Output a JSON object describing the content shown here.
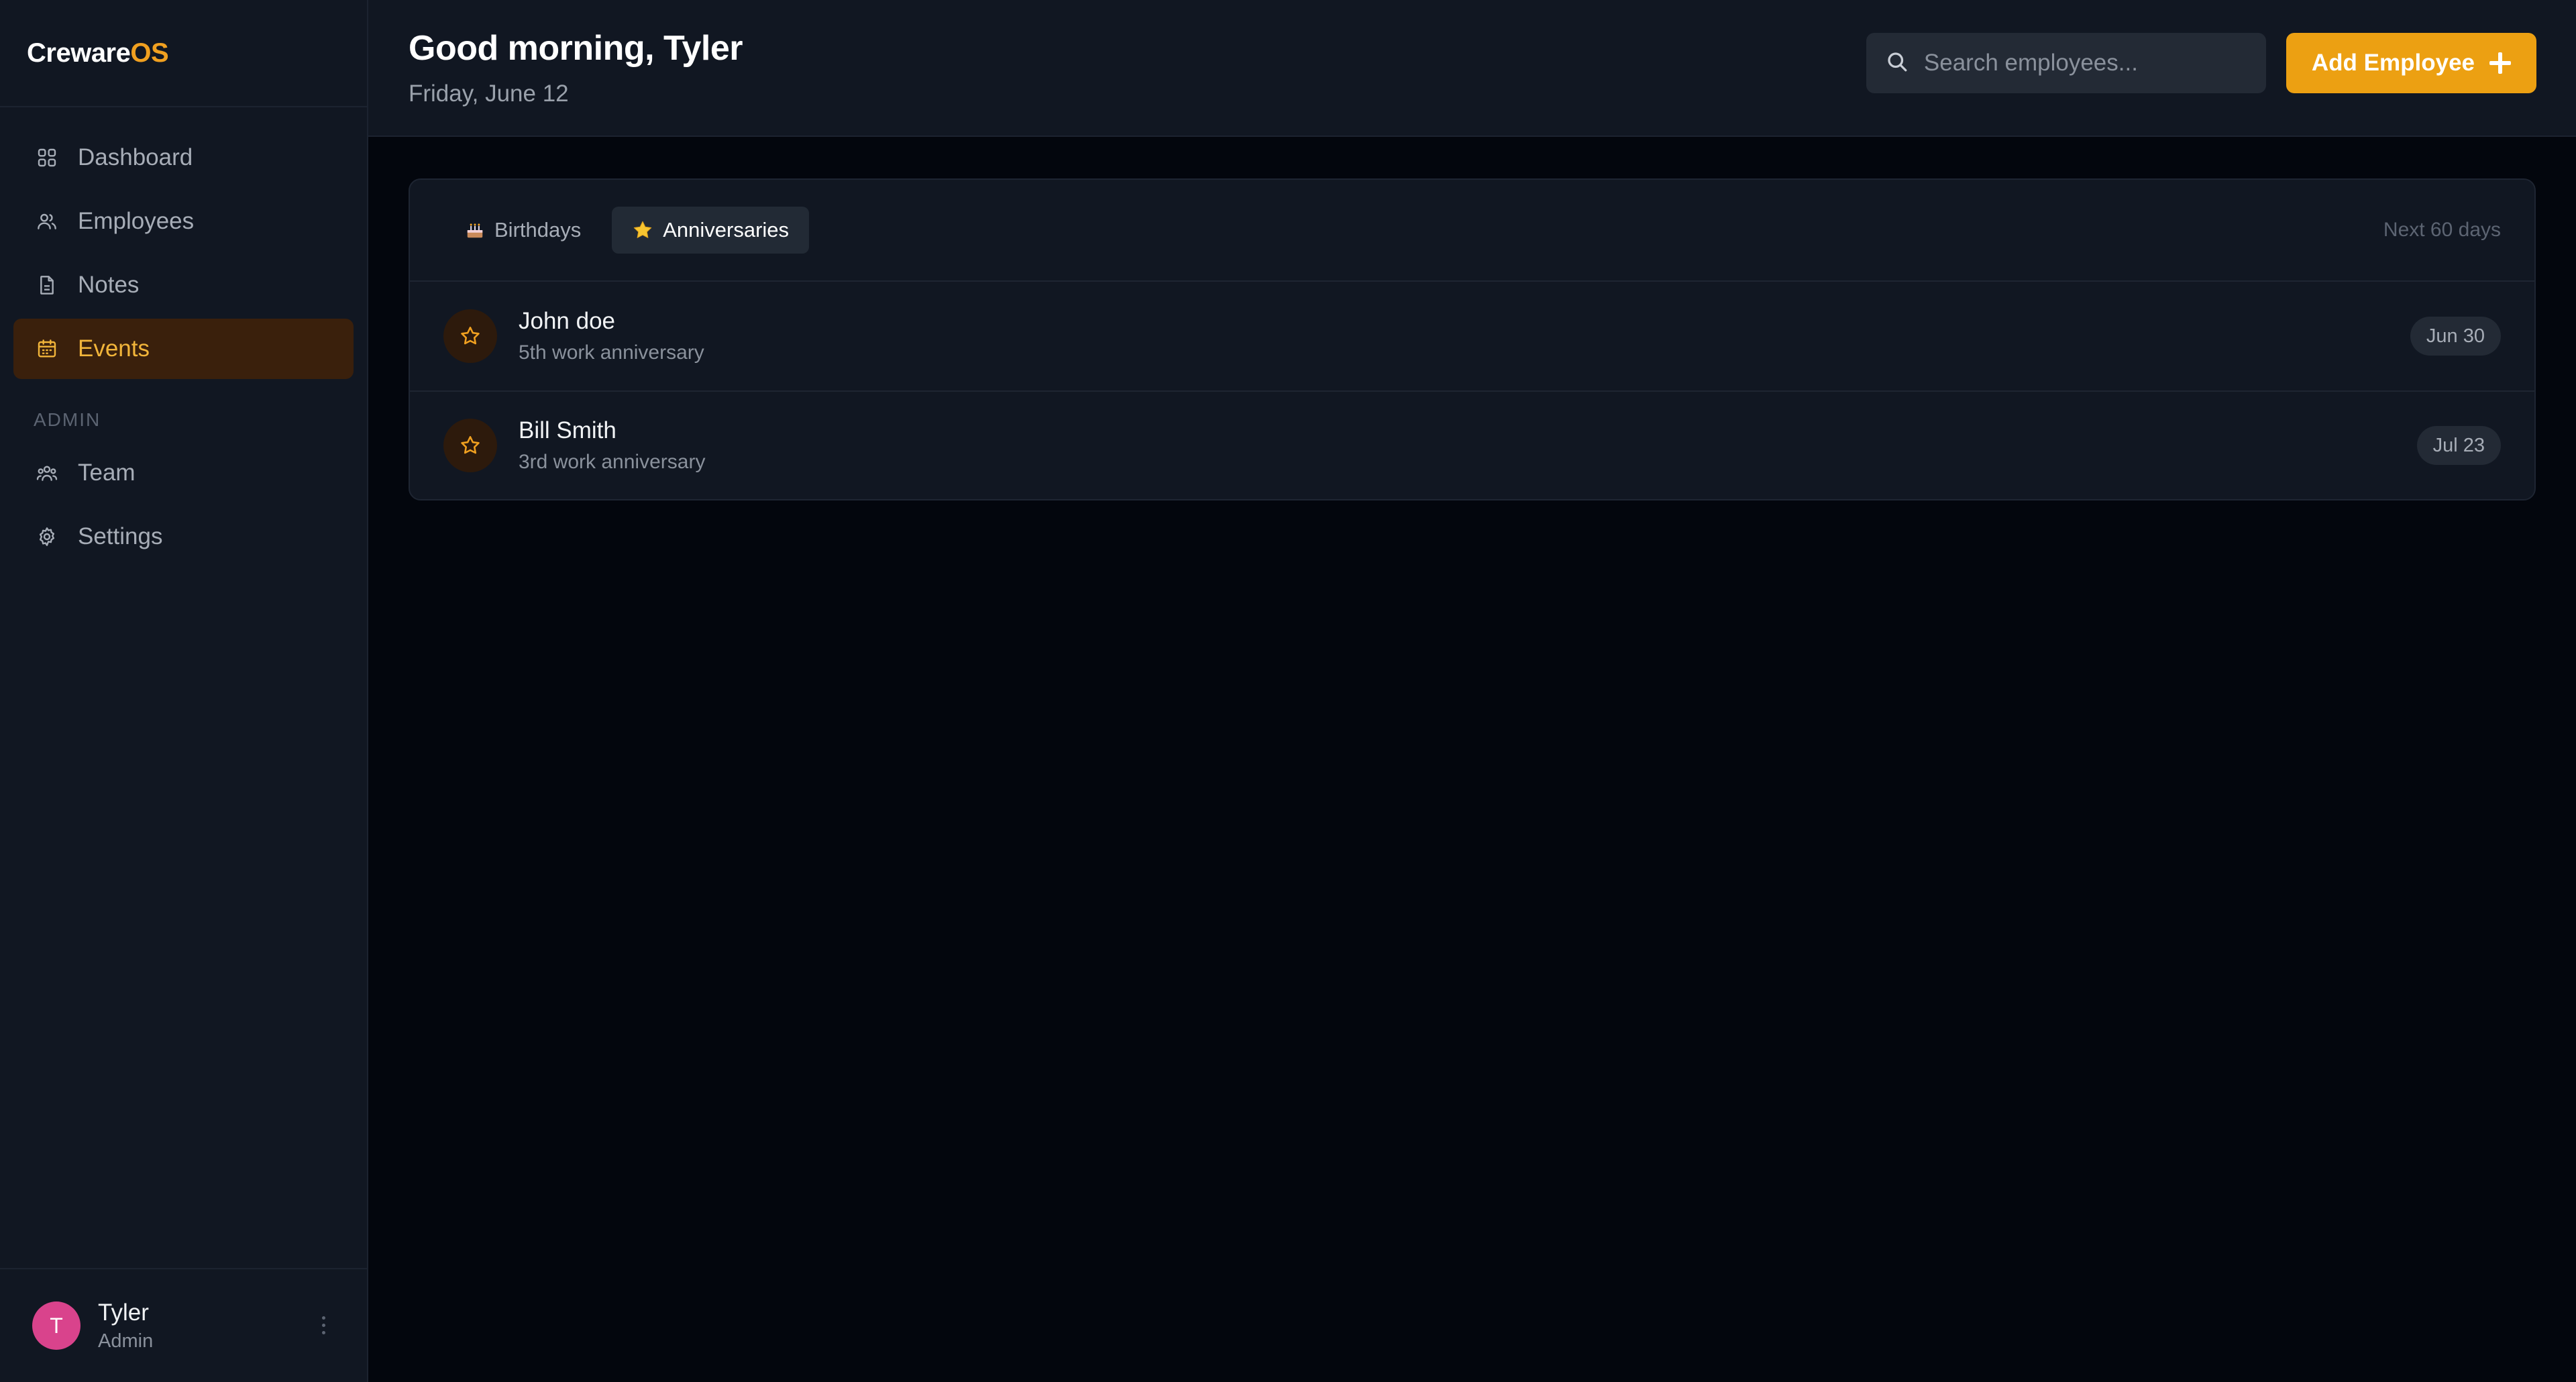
{
  "brand": {
    "part1": "Creware",
    "part2": "OS",
    "accent": "#f0a020"
  },
  "sidebar": {
    "items": [
      {
        "label": "Dashboard",
        "icon": "grid-icon"
      },
      {
        "label": "Employees",
        "icon": "users-icon"
      },
      {
        "label": "Notes",
        "icon": "document-icon"
      },
      {
        "label": "Events",
        "icon": "calendar-icon",
        "active": true
      }
    ],
    "admin_label": "ADMIN",
    "admin_items": [
      {
        "label": "Team",
        "icon": "team-icon"
      },
      {
        "label": "Settings",
        "icon": "gear-icon"
      }
    ]
  },
  "user": {
    "initial": "T",
    "name": "Tyler",
    "role": "Admin",
    "avatar_color": "#d9438c"
  },
  "header": {
    "greeting": "Good morning, Tyler",
    "date": "Friday, June 12",
    "search_placeholder": "Search employees...",
    "add_label": "Add Employee"
  },
  "events": {
    "tabs": [
      {
        "label": "Birthdays",
        "icon": "cake-icon",
        "active": false
      },
      {
        "label": "Anniversaries",
        "icon": "star-icon",
        "active": true
      }
    ],
    "range": "Next 60 days",
    "rows": [
      {
        "name": "John doe",
        "detail": "5th work anniversary",
        "date": "Jun 30"
      },
      {
        "name": "Bill Smith",
        "detail": "3rd work anniversary",
        "date": "Jul 23"
      }
    ]
  }
}
